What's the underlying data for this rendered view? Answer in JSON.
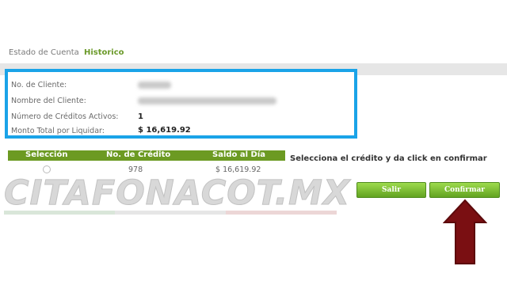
{
  "breadcrumb": {
    "prefix": "Estado de Cuenta",
    "active": "Historico"
  },
  "info": {
    "client_no_label": "No. de Cliente:",
    "client_name_label": "Nombre del Cliente:",
    "active_credits_label": "Número de Créditos Activos:",
    "active_credits_value": "1",
    "total_label": "Monto Total por Liquidar:",
    "total_value": "$ 16,619.92"
  },
  "table": {
    "headers": [
      "Selección",
      "No. de Crédito",
      "Saldo al Día"
    ],
    "rows": [
      {
        "credit_no": "978",
        "balance": "$ 16,619.92"
      }
    ]
  },
  "instruction": "Selecciona el crédito y da click en confirmar",
  "buttons": {
    "exit": "Salir",
    "confirm": "Confirmar"
  },
  "watermark": "CITAFONACOT.MX",
  "colors": {
    "highlight_border": "#1aa3e8",
    "brand_green": "#6c9a22",
    "arrow": "#7a0f12"
  },
  "icons": {
    "pointer": "up-arrow-icon"
  }
}
